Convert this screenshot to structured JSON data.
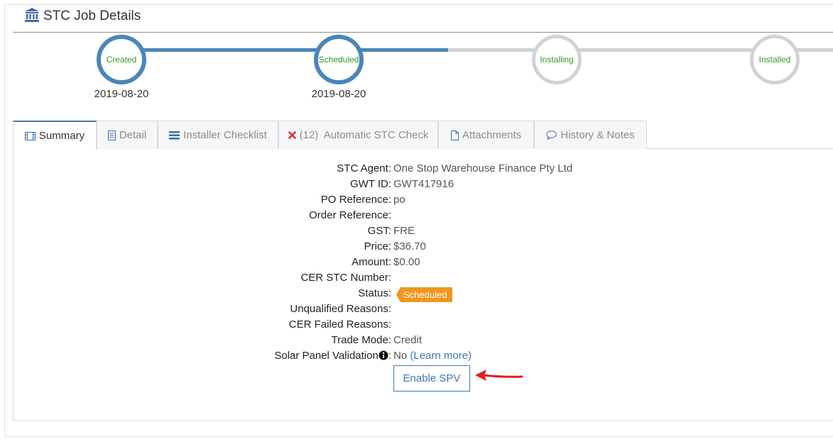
{
  "header": {
    "title": "STC Job Details",
    "icon": "bank-icon"
  },
  "progress": {
    "steps": [
      {
        "label": "Created",
        "date": "2019-08-20",
        "done": true
      },
      {
        "label": "Scheduled",
        "date": "2019-08-20",
        "done": true
      },
      {
        "label": "Installing",
        "date": "",
        "done": false
      },
      {
        "label": "Installed",
        "date": "",
        "done": false
      }
    ]
  },
  "tabs": [
    {
      "label": "Summary",
      "icon": "film-icon",
      "active": true
    },
    {
      "label": "Detail",
      "icon": "document-icon",
      "active": false
    },
    {
      "label": "Installer Checklist",
      "icon": "list-icon",
      "active": false
    },
    {
      "label": "(12)  Automatic STC Check",
      "icon": "error-x-icon",
      "active": false
    },
    {
      "label": "Attachments",
      "icon": "file-icon",
      "active": false
    },
    {
      "label": "History & Notes",
      "icon": "comment-icon",
      "active": false
    }
  ],
  "summary": {
    "stc_agent": {
      "label": "STC Agent:",
      "value": "One Stop Warehouse Finance Pty Ltd"
    },
    "gwt_id": {
      "label": "GWT ID:",
      "value": "GWT417916"
    },
    "po_ref": {
      "label": "PO Reference:",
      "value": "po"
    },
    "order_ref": {
      "label": "Order Reference:",
      "value": ""
    },
    "gst": {
      "label": "GST:",
      "value": "FRE"
    },
    "price": {
      "label": "Price:",
      "value": "$36.70"
    },
    "amount": {
      "label": "Amount:",
      "value": "$0.00"
    },
    "cer_number": {
      "label": "CER STC Number:",
      "value": ""
    },
    "status": {
      "label": "Status:",
      "value": "Scheduled"
    },
    "unqualified": {
      "label": "Unqualified Reasons:",
      "value": ""
    },
    "cer_failed": {
      "label": "CER Failed Reasons:",
      "value": ""
    },
    "trade_mode": {
      "label": "Trade Mode:",
      "value": "Credit"
    },
    "spv": {
      "label": "Solar Panel Validation",
      "label_suffix": ":",
      "value": "No",
      "link": "(Learn more)"
    }
  },
  "actions": {
    "enable_spv": "Enable SPV"
  },
  "colors": {
    "accent": "#3d7ab5",
    "progress_done": "#4a86b8",
    "progress_todo": "#cfd3d6",
    "step_text": "#2e9a2e",
    "status_badge": "#f0961e",
    "annotation_arrow": "#e02020"
  }
}
